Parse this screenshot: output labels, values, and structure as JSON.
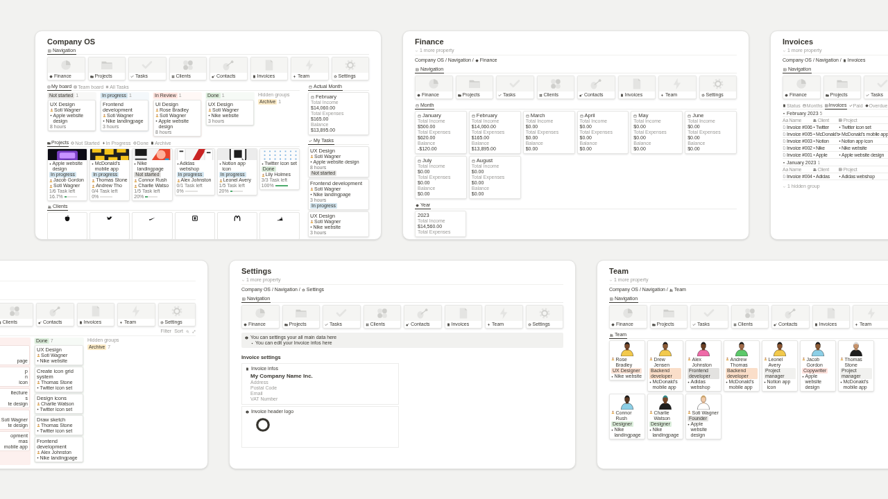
{
  "panels": [
    {
      "kind": "company_os",
      "title": "Company OS",
      "nav_tab": {
        "label": "Navigation",
        "kind": "table"
      },
      "nav": [
        {
          "kind": "chart",
          "label": "Finance"
        },
        {
          "kind": "folder",
          "label": "Projects"
        },
        {
          "kind": "check",
          "label": "Tasks"
        },
        {
          "kind": "circles",
          "label": "Clients"
        },
        {
          "kind": "pin",
          "label": "Contacts"
        },
        {
          "kind": "document",
          "label": "Invoices"
        },
        {
          "kind": "bolt",
          "label": "Team"
        },
        {
          "kind": "gear",
          "label": "Settings"
        }
      ],
      "board": {
        "tabs": [
          {
            "label": "My board",
            "kind": "board",
            "selected": true
          },
          {
            "label": "Team board",
            "kind": "board",
            "selected": false
          },
          {
            "label": "All Tasks",
            "kind": "list",
            "selected": false
          }
        ],
        "columns": [
          {
            "status": "Not started",
            "color": "#e3e2e0",
            "count": "1",
            "cards": [
              {
                "title": "UX Design",
                "people": [
                  "Soti Wagner"
                ],
                "project": "Apple website design",
                "hours": "8 hours"
              }
            ]
          },
          {
            "status": "In progress",
            "color": "#d3e5ef",
            "count": "1",
            "cards": [
              {
                "title": "Frontend development",
                "people": [
                  "Soti Wagner"
                ],
                "project": "Nike landingpage",
                "hours": "3 hours"
              }
            ]
          },
          {
            "status": "In Review",
            "color": "#ffe2dd",
            "count": "1",
            "cards": [
              {
                "title": "UI Design",
                "people": [
                  "Rose Bradley",
                  "Soti Wagner"
                ],
                "project": "Apple website design",
                "hours": "8 hours"
              }
            ]
          },
          {
            "status": "Done",
            "color": "#dbeddb",
            "count": "1",
            "cards": [
              {
                "title": "UX Design",
                "people": [
                  "Soti Wagner"
                ],
                "project": "Nike website",
                "hours": "3 hours"
              }
            ]
          }
        ],
        "hidden": {
          "label": "Hidden groups",
          "groups": [
            {
              "status": "Archive",
              "color": "#fdecc8",
              "count": "1"
            }
          ]
        }
      },
      "projects": {
        "tabs": [
          {
            "label": "Projects",
            "kind": "folder",
            "selected": true
          },
          {
            "label": "Not Started",
            "kind": "dot",
            "selected": false
          },
          {
            "label": "In Progress",
            "kind": "bolt",
            "selected": false
          },
          {
            "label": "Done",
            "kind": "dot",
            "selected": false
          },
          {
            "label": "Archive",
            "kind": "document",
            "selected": false
          }
        ],
        "cards": [
          {
            "kind": "picture",
            "name": "Apple website design",
            "status": "In progress",
            "color": "#d3e5ef",
            "people": [
              "Jacob Gordon",
              "Soti Wagner"
            ],
            "tasks": "1/6 Task left",
            "percent": "16.7%",
            "level": 0.167
          },
          {
            "kind": "picture",
            "name": "McDonald's mobile app",
            "status": "In progress",
            "color": "#d3e5ef",
            "people": [
              "Thomas Stone",
              "Andrew Tho"
            ],
            "tasks": "0/4 Task left",
            "percent": "0%",
            "level": 0
          },
          {
            "kind": "picture",
            "name": "Nike landingpage",
            "status": "Not started",
            "color": "#e3e2e0",
            "people": [
              "Connor Rush",
              "Charlie Watso"
            ],
            "tasks": "1/5 Task left",
            "percent": "20%",
            "level": 0.2
          },
          {
            "kind": "picture",
            "name": "Adidas webshop",
            "status": "In progress",
            "color": "#d3e5ef",
            "people": [
              "Alex Johnston"
            ],
            "tasks": "0/1 Task left",
            "percent": "0%",
            "level": 0
          },
          {
            "kind": "picture",
            "name": "Notion app icon",
            "status": "In progress",
            "color": "#d3e5ef",
            "people": [
              "Leonel Avery"
            ],
            "tasks": "1/5 Task left",
            "percent": "20%",
            "level": 0.2
          },
          {
            "kind": "picture",
            "name": "Twitter icon set",
            "status": "Done",
            "color": "#dbeddb",
            "people": [
              "Lily Holmes"
            ],
            "tasks": "3/3 Task left",
            "percent": "100%",
            "level": 1
          }
        ]
      },
      "clients": {
        "tab": {
          "label": "Clients",
          "kind": "people"
        },
        "logos": [
          {
            "kind": "fruit"
          },
          {
            "kind": "bird"
          },
          {
            "kind": "swoosh"
          },
          {
            "kind": "square"
          },
          {
            "kind": "arches"
          },
          {
            "kind": "stripes"
          }
        ]
      },
      "month_tab": {
        "label": "Actual Month",
        "kind": "calendar"
      },
      "month": {
        "name": "February",
        "fields": [
          {
            "label": "Total Income",
            "value": "$14,060.00"
          },
          {
            "label": "Total Expenses",
            "value": "$165.00"
          },
          {
            "label": "Balance",
            "value": "$13,895.00"
          }
        ]
      },
      "tasks_tab": {
        "label": "My Tasks",
        "kind": "check"
      },
      "tasks": [
        {
          "title": "UX Design",
          "people": [
            "Soti Wagner"
          ],
          "project": "Apple website design",
          "hours": "8 hours",
          "status": "Not started",
          "color": "#e3e2e0"
        },
        {
          "title": "Frontend development",
          "people": [
            "Soti Wagner"
          ],
          "project": "Nike landingpage",
          "hours": "3 hours",
          "status": "In progress",
          "color": "#d3e5ef"
        },
        {
          "title": "UX Design",
          "people": [
            "Soti Wagner"
          ],
          "project": "Nike website",
          "hours": "3 hours"
        }
      ]
    },
    {
      "kind": "finance",
      "title": "Finance",
      "property": "1 more property",
      "breadcrumb": {
        "path": "Company OS / Navigation /",
        "page": "Finance",
        "kind": "chart"
      },
      "nav_tab": {
        "label": "Navigation",
        "kind": "table"
      },
      "nav": [
        {
          "kind": "chart",
          "label": "Finance"
        },
        {
          "kind": "folder",
          "label": "Projects"
        },
        {
          "kind": "check",
          "label": "Tasks"
        },
        {
          "kind": "circles",
          "label": "Clients"
        },
        {
          "kind": "pin",
          "label": "Contacts"
        },
        {
          "kind": "document",
          "label": "Invoices"
        },
        {
          "kind": "bolt",
          "label": "Team"
        },
        {
          "kind": "gear",
          "label": "Settings"
        }
      ],
      "month_tab": {
        "label": "Month",
        "kind": "calendar"
      },
      "months": [
        {
          "name": "January",
          "fields": [
            {
              "label": "Total Income",
              "value": "$500.00"
            },
            {
              "label": "Total Expenses",
              "value": "$620.00"
            },
            {
              "label": "Balance",
              "value": "-$120.00"
            }
          ]
        },
        {
          "name": "February",
          "fields": [
            {
              "label": "Total Income",
              "value": "$14,060.00"
            },
            {
              "label": "Total Expenses",
              "value": "$165.00"
            },
            {
              "label": "Balance",
              "value": "$13,895.00"
            }
          ]
        },
        {
          "name": "March",
          "fields": [
            {
              "label": "Total Income",
              "value": "$0.00"
            },
            {
              "label": "Total Expenses",
              "value": "$0.00"
            },
            {
              "label": "Balance",
              "value": "$0.00"
            }
          ]
        },
        {
          "name": "April",
          "fields": [
            {
              "label": "Total Income",
              "value": "$0.00"
            },
            {
              "label": "Total Expenses",
              "value": "$0.00"
            },
            {
              "label": "Balance",
              "value": "$0.00"
            }
          ]
        },
        {
          "name": "May",
          "fields": [
            {
              "label": "Total Income",
              "value": "$0.00"
            },
            {
              "label": "Total Expenses",
              "value": "$0.00"
            },
            {
              "label": "Balance",
              "value": "$0.00"
            }
          ]
        },
        {
          "name": "June",
          "fields": [
            {
              "label": "Total Income",
              "value": "$0.00"
            },
            {
              "label": "Total Expenses",
              "value": "$0.00"
            },
            {
              "label": "Balance",
              "value": "$0.00"
            }
          ]
        },
        {
          "name": "July",
          "fields": [
            {
              "label": "Total Income",
              "value": "$0.00"
            },
            {
              "label": "Total Expenses",
              "value": "$0.00"
            },
            {
              "label": "Balance",
              "value": "$0.00"
            }
          ]
        },
        {
          "name": "August",
          "fields": [
            {
              "label": "Total Income",
              "value": "$0.00"
            },
            {
              "label": "Total Expenses",
              "value": "$0.00"
            },
            {
              "label": "Balance",
              "value": "$0.00"
            }
          ]
        }
      ],
      "year_tab": {
        "label": "Year",
        "kind": "chart"
      },
      "years": [
        {
          "name": "2023",
          "fields": [
            {
              "label": "Total Income",
              "value": "$14,560.00"
            },
            {
              "label": "Total Expenses"
            }
          ]
        }
      ]
    },
    {
      "kind": "invoices",
      "title": "Invoices",
      "property": "1 more property",
      "breadcrumb": {
        "path": "Company OS / Navigation /",
        "page": "Invoices",
        "kind": "document"
      },
      "nav_tab": {
        "label": "Navigation",
        "kind": "table"
      },
      "nav": [
        {
          "kind": "chart",
          "label": "Finance"
        },
        {
          "kind": "folder",
          "label": "Projects"
        },
        {
          "kind": "check",
          "label": "Tasks"
        }
      ],
      "views": [
        {
          "label": "Status",
          "kind": "document",
          "selected": false
        },
        {
          "label": "Months",
          "kind": "calendar",
          "selected": false
        },
        {
          "label": "Invoices",
          "kind": "table",
          "selected": true
        },
        {
          "label": "Paid",
          "kind": "check",
          "selected": false
        },
        {
          "label": "Overdue",
          "kind": "chart",
          "selected": false
        }
      ],
      "groups": [
        {
          "title": "February 2023",
          "count": "5",
          "columns": [
            {
              "label": "Name",
              "glyph": "Aa"
            },
            {
              "label": "Client"
            },
            {
              "label": "Project"
            }
          ],
          "rows": [
            [
              "Invoice #006",
              "Twitter",
              "Twitter icon set"
            ],
            [
              "Invoice #005",
              "McDonald's",
              "McDonald's mobile app"
            ],
            [
              "Invoice #003",
              "Notion",
              "Notion app icon"
            ],
            [
              "Invoice #002",
              "Nike",
              "Nike website"
            ],
            [
              "Invoice #001",
              "Apple",
              "Apple website design"
            ]
          ]
        },
        {
          "title": "January 2023",
          "count": "1",
          "columns": [
            {
              "label": "Name",
              "glyph": "Aa"
            },
            {
              "label": "Client"
            },
            {
              "label": "Project"
            }
          ],
          "rows": [
            [
              "Invoice #004",
              "Adidas",
              "Adidas webshop"
            ]
          ]
        }
      ],
      "hidden": "1 hidden group"
    },
    {
      "kind": "board",
      "nav": [
        {
          "kind": "circles",
          "label": "Clients"
        },
        {
          "kind": "pin",
          "label": "Contacts"
        },
        {
          "kind": "document",
          "label": "Invoices"
        },
        {
          "kind": "bolt",
          "label": "Team"
        },
        {
          "kind": "gear",
          "label": "Settings"
        }
      ],
      "toolbar": [
        "Filter",
        "Sort"
      ],
      "partial": {
        "color": "#fdf0ee",
        "cards": [
          {
            "project_end": "page"
          },
          {
            "title_end": "p",
            "person_end": "n",
            "project_end": "icon"
          },
          {
            "title_end": "itecture",
            "person_end": "s",
            "project_end": "te design"
          },
          {
            "people": [
              "Soti Wagner"
            ],
            "project_end": "te design"
          },
          {
            "title_end": "opment",
            "person_end": "mas",
            "project_end": "mobile app"
          }
        ]
      },
      "column": {
        "status": "Done",
        "color": "#dbeddb",
        "count": "7",
        "cards": [
          {
            "title": "UX Design",
            "people": [
              "Soti Wagner"
            ],
            "project": "Nike website"
          },
          {
            "title": "Create icon grid system",
            "people": [
              "Thomas Stone"
            ],
            "project": "Twitter icon set"
          },
          {
            "title": "Design icons",
            "people": [
              "Charlie Watson"
            ],
            "project": "Twitter icon set"
          },
          {
            "title": "Draw sketch",
            "people": [
              "Thomas Stone"
            ],
            "project": "Twitter icon set"
          },
          {
            "title": "Frontend development",
            "people": [
              "Alex Johnston"
            ],
            "project": "Nike landingpage"
          }
        ]
      },
      "hidden": {
        "label": "Hidden groups",
        "groups": [
          {
            "status": "Archive",
            "color": "#fdecc8",
            "count": "7"
          }
        ]
      }
    },
    {
      "kind": "settings",
      "title": "Settings",
      "property": "1 more property",
      "breadcrumb": {
        "path": "Company OS / Navigation /",
        "page": "Settings",
        "kind": "gear"
      },
      "nav_tab": {
        "label": "Navigation",
        "kind": "table"
      },
      "nav": [
        {
          "kind": "chart",
          "label": "Finance"
        },
        {
          "kind": "folder",
          "label": "Projects"
        },
        {
          "kind": "check",
          "label": "Tasks"
        },
        {
          "kind": "circles",
          "label": "Clients"
        },
        {
          "kind": "pin",
          "label": "Contacts"
        },
        {
          "kind": "document",
          "label": "Invoices"
        },
        {
          "kind": "bolt",
          "label": "Team"
        },
        {
          "kind": "gear",
          "label": "Settings"
        }
      ],
      "callout": {
        "text": "You can settings your all main data here",
        "bullet": "You can edit your Invoice infos here"
      },
      "heading": "Invoice settings",
      "infos": {
        "title": "Invoice infos",
        "company": "My Company Name Inc.",
        "lines": [
          "Address",
          "Postal Code",
          "Email",
          "VAT Number"
        ]
      },
      "logo": {
        "title": "Invoice header logo"
      }
    },
    {
      "kind": "team",
      "title": "Team",
      "property": "1 more property",
      "breadcrumb": {
        "path": "Company OS / Navigation /",
        "page": "Team",
        "kind": "people"
      },
      "nav_tab": {
        "label": "Navigation",
        "kind": "table"
      },
      "nav": [
        {
          "kind": "chart",
          "label": "Finance"
        },
        {
          "kind": "folder",
          "label": "Projects"
        },
        {
          "kind": "check",
          "label": "Tasks"
        },
        {
          "kind": "circles",
          "label": "Clients"
        },
        {
          "kind": "pin",
          "label": "Contacts"
        },
        {
          "kind": "document",
          "label": "Invoices"
        },
        {
          "kind": "bolt",
          "label": "Team"
        }
      ],
      "team_tab": {
        "label": "Team",
        "kind": "people"
      },
      "members": [
        {
          "name": "Rose Bradley",
          "role": "UX Designer",
          "color": "#fbe2d5",
          "project": "Nike website"
        },
        {
          "name": "Drew Jensen",
          "role": "Backend developer",
          "color": "#fadec9",
          "project": "McDonald's mobile app"
        },
        {
          "name": "Alex Johnston",
          "role": "Frontend developer",
          "color": "#e3e2e0",
          "project": "Adidas webshop"
        },
        {
          "name": "Andrew Thomas",
          "role": "Backend developer",
          "color": "#fadec9",
          "project": "McDonald's mobile app"
        },
        {
          "name": "Leonel Avery",
          "role": "Project manager",
          "color": "#f1f1ef",
          "project": "Notion app icon"
        },
        {
          "name": "Jacob Gordon",
          "role": "Copywriter",
          "color": "#ffe2dd",
          "project": "Apple website design"
        },
        {
          "name": "Thomas Stone",
          "role": "Project manager",
          "color": "#f1f1ef",
          "project": "McDonald's mobile app"
        },
        {
          "name": "Connor Rush",
          "role": "Designer",
          "color": "#dbeddb",
          "project": "Nike landingpage"
        },
        {
          "name": "Charlie Watson",
          "role": "Designer",
          "color": "#dbeddb",
          "project": "Nike landingpage"
        },
        {
          "name": "Soti Wagner",
          "role": "Founder",
          "color": "#e3e2e0",
          "project": "Apple website design"
        }
      ]
    }
  ]
}
